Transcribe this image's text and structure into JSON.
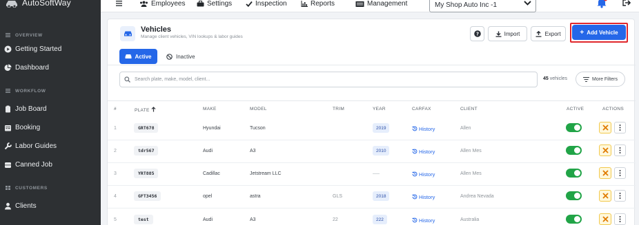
{
  "brand": {
    "name": "AutoSoftWay"
  },
  "sidebar": {
    "sections": [
      {
        "label": "OVERVIEW",
        "items": [
          {
            "label": "Getting Started",
            "icon": "play-circle-icon"
          },
          {
            "label": "Dashboard",
            "icon": "pie-chart-icon"
          }
        ]
      },
      {
        "label": "WORKFLOW",
        "items": [
          {
            "label": "Job Board",
            "icon": "clipboard-icon"
          },
          {
            "label": "Booking",
            "icon": "calendar-icon"
          },
          {
            "label": "Labor Guides",
            "icon": "wrench-icon"
          },
          {
            "label": "Canned Job",
            "icon": "database-icon"
          }
        ]
      },
      {
        "label": "CUSTOMERS",
        "items": [
          {
            "label": "Clients",
            "icon": "user-icon"
          }
        ]
      }
    ]
  },
  "topnav": {
    "items": [
      {
        "label": "Employees",
        "icon": "users-icon"
      },
      {
        "label": "Settings",
        "icon": "toolbox-icon"
      },
      {
        "label": "Inspection",
        "icon": "check-icon"
      },
      {
        "label": "Reports",
        "icon": "bar-chart-icon"
      },
      {
        "label": "Management",
        "icon": "building-icon"
      }
    ],
    "shop": "My Shop Auto Inc -1"
  },
  "page": {
    "title": "Vehicles",
    "subtitle": "Manage client vehicles, VIN lookups & labor guides",
    "import_label": "Import",
    "export_label": "Export",
    "add_label": "Add Vehicle",
    "tab_active": "Active",
    "tab_inactive": "Inactive",
    "search_placeholder": "Search plate, make, model, client...",
    "count_number": "45",
    "count_suffix": "vehicles",
    "filters_label": "More Filters"
  },
  "table": {
    "headers": {
      "num": "#",
      "plate": "PLATE",
      "make": "MAKE",
      "model": "MODEL",
      "trim": "TRIM",
      "year": "YEAR",
      "carfax": "CARFAX",
      "client": "CLIENT",
      "active": "ACTIVE",
      "actions": "ACTIONS"
    },
    "rows": [
      {
        "num": "1",
        "plate": "GRT678",
        "make": "Hyundai",
        "model": "Tucson",
        "trim": "",
        "year": "2019",
        "carfax": "History",
        "client": "Allen",
        "active": true
      },
      {
        "num": "2",
        "plate": "tdr567",
        "make": "Audi",
        "model": "A3",
        "trim": "",
        "year": "2010",
        "carfax": "History",
        "client": "Allen Mes",
        "active": true
      },
      {
        "num": "3",
        "plate": "YRT885",
        "make": "Cadillac",
        "model": "Jetstream LLC",
        "trim": "",
        "year": "",
        "carfax": "History",
        "client": "Allen Mes",
        "active": true
      },
      {
        "num": "4",
        "plate": "GFT3456",
        "make": "opel",
        "model": "astra",
        "trim": "GLS",
        "year": "2018",
        "carfax": "History",
        "client": "Andrea Nevada",
        "active": true
      },
      {
        "num": "5",
        "plate": "test",
        "make": "Audi",
        "model": "A3",
        "trim": "22",
        "year": "222",
        "carfax": "History",
        "client": "Australia",
        "active": true
      }
    ]
  },
  "colors": {
    "primary": "#2567e8",
    "sidebar": "#2d3033",
    "toggle_on": "#21a447",
    "highlight": "#e0262b",
    "warn": "#f2c94c"
  }
}
